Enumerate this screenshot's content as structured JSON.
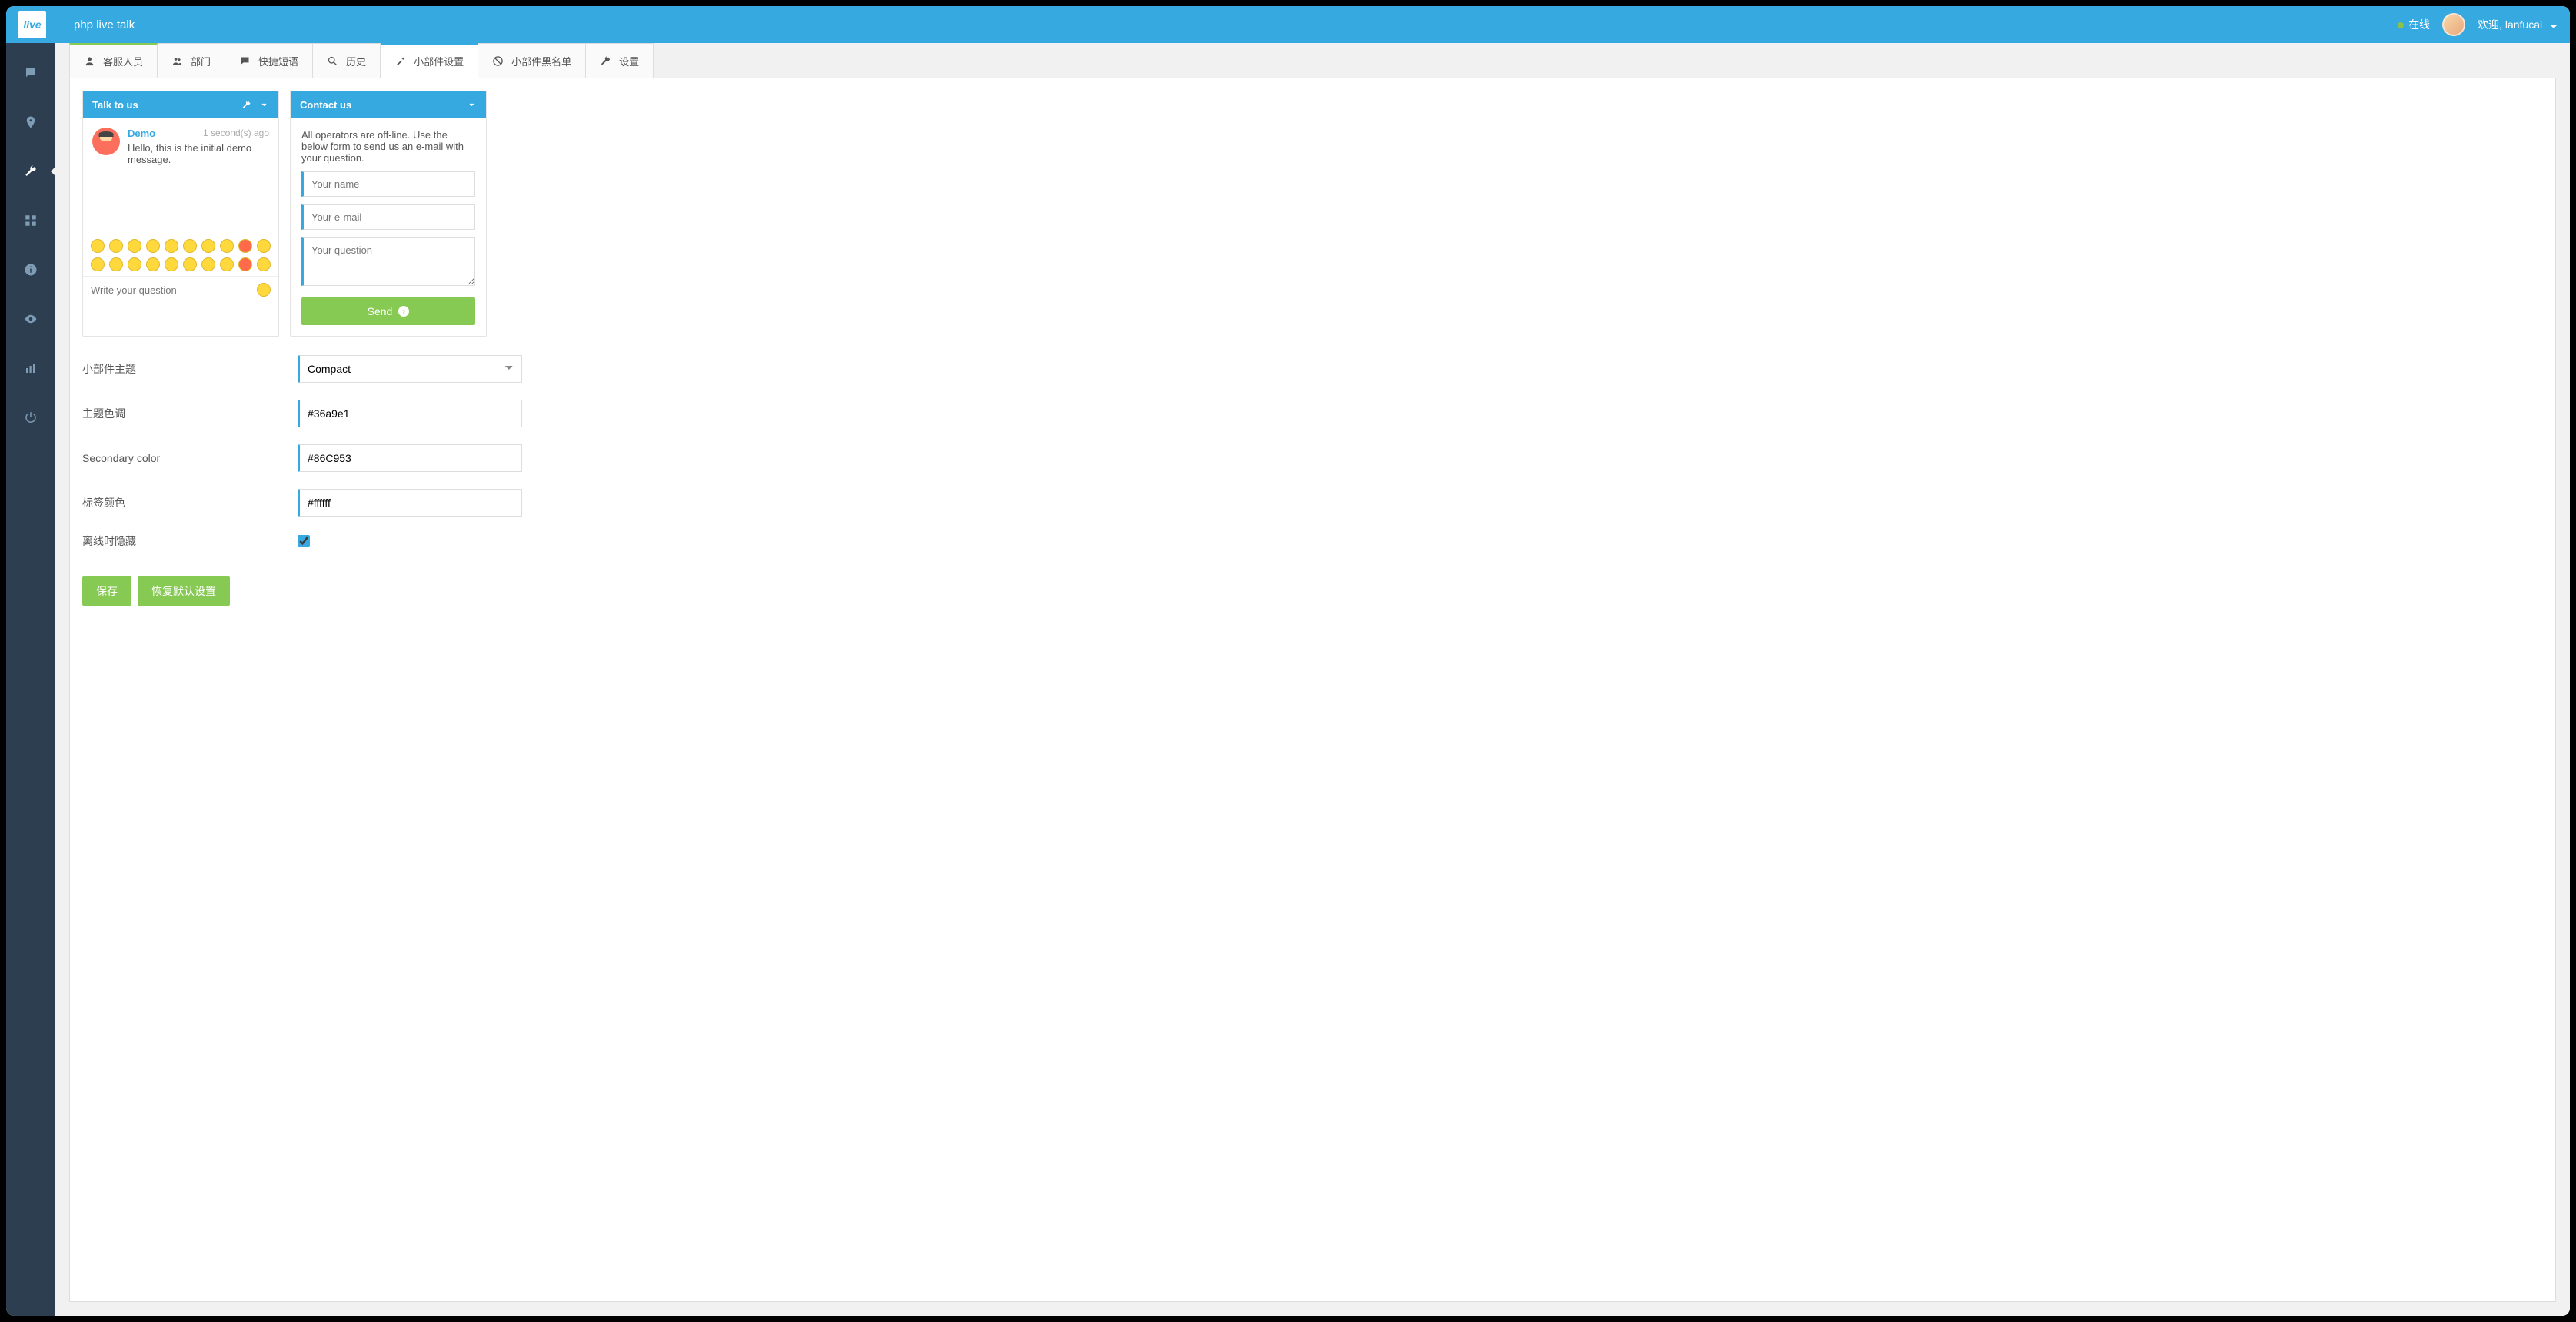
{
  "header": {
    "logo_text": "live",
    "title": "php live talk",
    "status_label": "在线",
    "welcome_prefix": "欢迎,",
    "username": "lanfucai"
  },
  "sidebar": {
    "items": [
      {
        "name": "chat",
        "icon": "chat"
      },
      {
        "name": "map",
        "icon": "pin"
      },
      {
        "name": "settings",
        "icon": "wrench",
        "active": true
      },
      {
        "name": "qr",
        "icon": "grid"
      },
      {
        "name": "info",
        "icon": "info"
      },
      {
        "name": "monitor",
        "icon": "eye"
      },
      {
        "name": "stats",
        "icon": "bars"
      },
      {
        "name": "power",
        "icon": "power"
      }
    ]
  },
  "tabs": [
    {
      "label": "客服人员",
      "icon": "user"
    },
    {
      "label": "部门",
      "icon": "users"
    },
    {
      "label": "快捷短语",
      "icon": "comment"
    },
    {
      "label": "历史",
      "icon": "search"
    },
    {
      "label": "小部件设置",
      "icon": "magic",
      "active": true
    },
    {
      "label": "小部件黑名单",
      "icon": "ban"
    },
    {
      "label": "设置",
      "icon": "wrench"
    }
  ],
  "preview": {
    "talk": {
      "title": "Talk to us",
      "demo_name": "Demo",
      "demo_time": "1 second(s) ago",
      "demo_msg": "Hello, this is the initial demo message.",
      "input_placeholder": "Write your question"
    },
    "contact": {
      "title": "Contact us",
      "intro": "All operators are off-line. Use the below form to send us an e-mail with your question.",
      "name_placeholder": "Your name",
      "email_placeholder": "Your e-mail",
      "question_placeholder": "Your question",
      "send_label": "Send"
    }
  },
  "form": {
    "theme": {
      "label": "小部件主题",
      "value": "Compact"
    },
    "primary": {
      "label": "主题色调",
      "value": "#36a9e1"
    },
    "secondary": {
      "label": "Secondary color",
      "value": "#86C953"
    },
    "tag_color": {
      "label": "标签颜色",
      "value": "#ffffff"
    },
    "hide_offline": {
      "label": "离线时隐藏",
      "checked": true
    }
  },
  "buttons": {
    "save": "保存",
    "reset": "恢复默认设置"
  }
}
